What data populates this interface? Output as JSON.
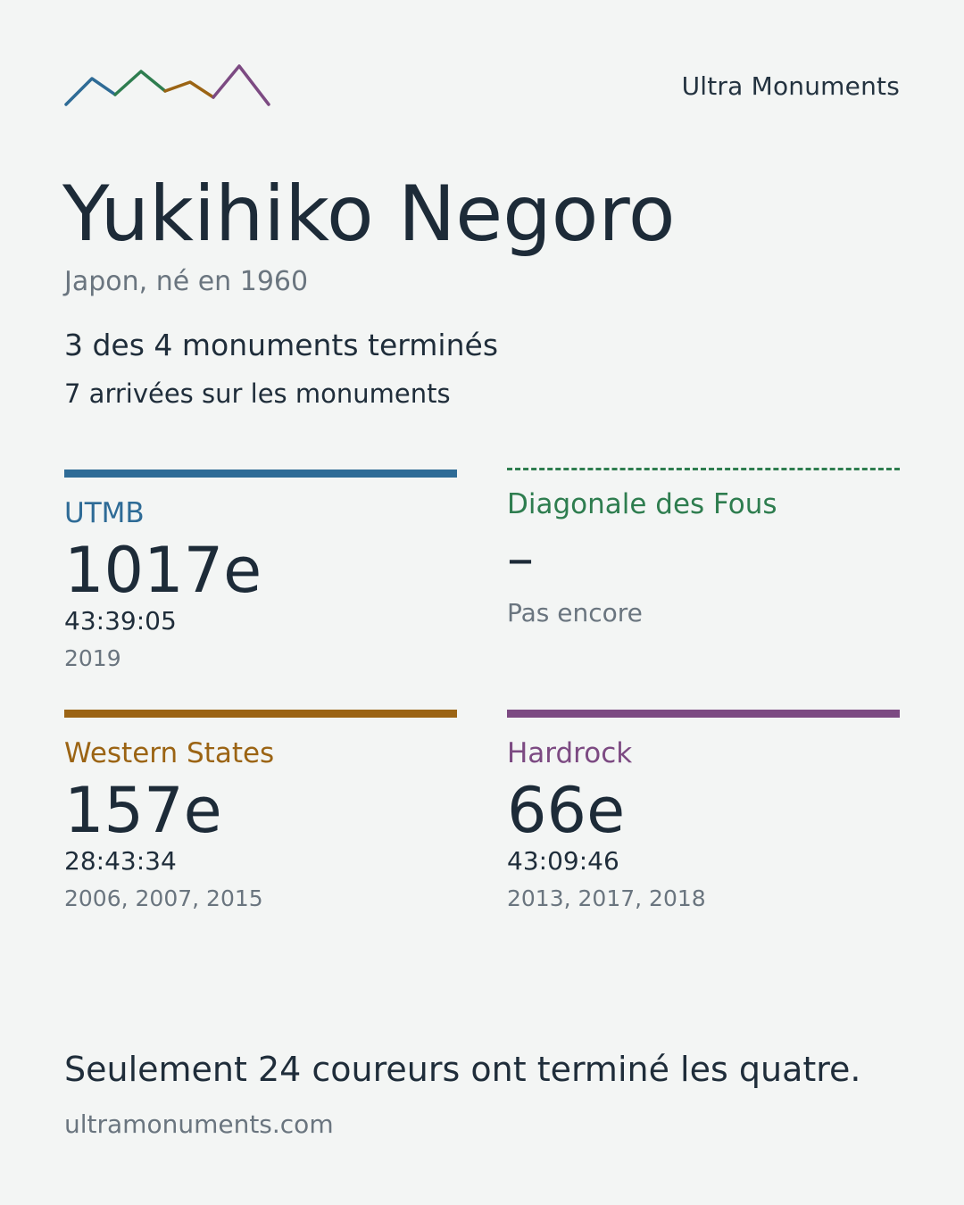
{
  "header": {
    "brand": "Ultra Monuments",
    "logo_colors": [
      "#2e6b96",
      "#2e7d4f",
      "#9b6414",
      "#7c4a82"
    ]
  },
  "runner": {
    "name": "Yukihiko Negoro",
    "origin": "Japon, né en 1960",
    "completed": "3 des 4 monuments terminés",
    "finishes": "7 arrivées sur les monuments"
  },
  "races": [
    {
      "name": "UTMB",
      "color": "#2e6b96",
      "rank": "1017e",
      "time": "43:39:05",
      "years": "2019",
      "finished": true
    },
    {
      "name": "Diagonale des Fous",
      "color": "#2e7d4f",
      "rank": "–",
      "status": "Pas encore",
      "finished": false
    },
    {
      "name": "Western States",
      "color": "#9b6414",
      "rank": "157e",
      "time": "28:43:34",
      "years": "2006, 2007, 2015",
      "finished": true
    },
    {
      "name": "Hardrock",
      "color": "#7c4a82",
      "rank": "66e",
      "time": "43:09:46",
      "years": "2013, 2017, 2018",
      "finished": true
    }
  ],
  "footer": {
    "note": "Seulement 24 coureurs ont terminé les quatre.",
    "site": "ultramonuments.com"
  }
}
